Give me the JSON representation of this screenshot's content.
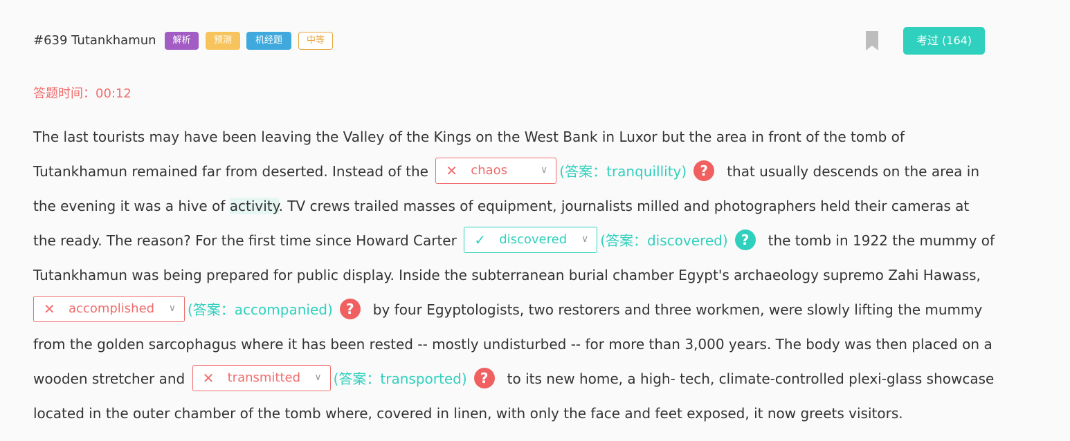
{
  "question": {
    "title": "#639 Tutankhamun",
    "tags": [
      "解析",
      "预测",
      "机经题",
      "中等"
    ],
    "exam_button": "考过 (164)",
    "timer": "答题时间：00:12"
  },
  "icons": {
    "bookmark": "bookmark-icon",
    "wrong": "close-icon",
    "correct": "check-icon",
    "help": "question-icon",
    "dropdown": "chevron-down-icon"
  },
  "colors": {
    "accent": "#2fd0bd",
    "error": "#f06c6c",
    "purple": "#a25cc4",
    "yellow": "#f7c35c",
    "blue": "#3fa9dd",
    "orange": "#e8a33a"
  },
  "passage": {
    "t1": "The last tourists may have been leaving the Valley of the Kings on the West Bank in Luxor but the area in front of the tomb of Tutankhamun remained far from deserted. Instead of the",
    "t2": "that usually descends on the area in the evening it was a hive of",
    "hl": "activity",
    "t3": ". TV crews trailed masses of equipment, journalists milled and photographers held their cameras at the ready. The reason? For the first time since Howard Carter",
    "t4": "the tomb in 1922 the mummy of Tutankhamun was being prepared for public display. Inside the subterranean burial chamber Egypt's archaeology supremo Zahi Hawass,",
    "t5": "by four Egyptologists, two restorers and three workmen, were slowly lifting the mummy from the golden sarcophagus where it has been rested -- mostly undisturbed -- for more than 3,000 years. The body was then placed on a wooden stretcher and",
    "t6": "to its new home, a high- tech, climate-controlled plexi-glass showcase located in the outer chamber of the tomb where, covered in linen, with only the face and feet exposed, it now greets visitors."
  },
  "blanks": [
    {
      "mark": "✕",
      "value": "chaos",
      "answer": "(答案：tranquillity)",
      "status": "wrong"
    },
    {
      "mark": "✓",
      "value": "discovered",
      "answer": "(答案：discovered)",
      "status": "correct"
    },
    {
      "mark": "✕",
      "value": "accomplished",
      "answer": "(答案：accompanied)",
      "status": "wrong"
    },
    {
      "mark": "✕",
      "value": "transmitted",
      "answer": "(答案：transported)",
      "status": "wrong"
    }
  ],
  "symbols": {
    "dropdown": "∨",
    "help": "?"
  }
}
